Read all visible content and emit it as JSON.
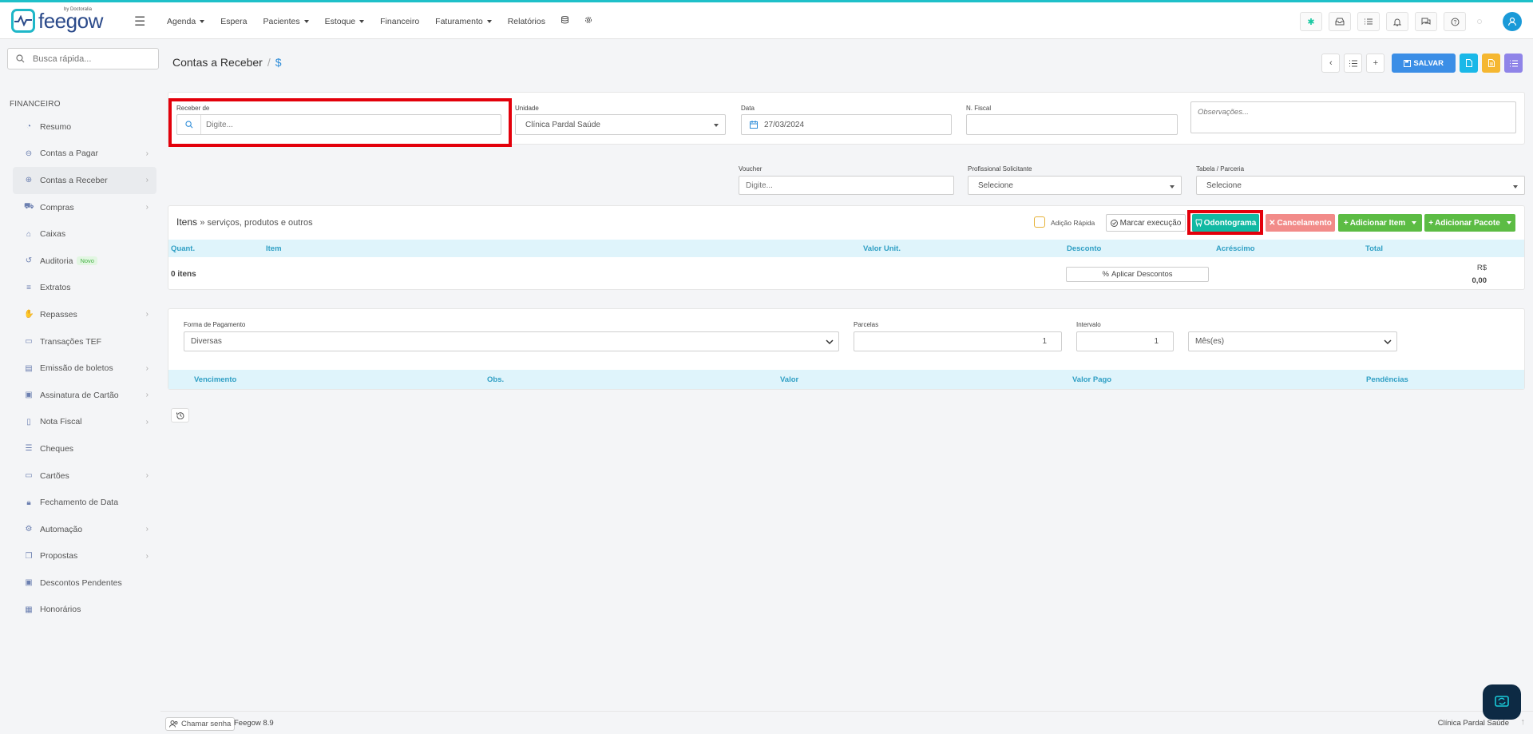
{
  "brand": {
    "name": "feegow",
    "sub": "by Doctoralia"
  },
  "topnav": {
    "items": [
      {
        "label": "Agenda",
        "dropdown": true
      },
      {
        "label": "Espera",
        "dropdown": false
      },
      {
        "label": "Pacientes",
        "dropdown": true
      },
      {
        "label": "Estoque",
        "dropdown": true
      },
      {
        "label": "Financeiro",
        "dropdown": false
      },
      {
        "label": "Faturamento",
        "dropdown": true
      },
      {
        "label": "Relatórios",
        "dropdown": false
      }
    ],
    "extra_icons": [
      "database-icon",
      "settings-icon"
    ]
  },
  "header_right": {
    "icons": [
      "star-icon",
      "inbox-icon",
      "tasks-icon",
      "bell-icon",
      "chat-icon",
      "help-icon"
    ]
  },
  "sidebar": {
    "search_placeholder": "Busca rápida...",
    "section_title": "FINANCEIRO",
    "items": [
      {
        "label": "Resumo",
        "icon": "chart-icon",
        "chevron": false
      },
      {
        "label": "Contas a Pagar",
        "icon": "minus-circle-icon",
        "chevron": true
      },
      {
        "label": "Contas a Receber",
        "icon": "plus-circle-icon",
        "chevron": true,
        "active": true
      },
      {
        "label": "Compras",
        "icon": "cart-icon",
        "chevron": true
      },
      {
        "label": "Caixas",
        "icon": "box-icon",
        "chevron": false
      },
      {
        "label": "Auditoria",
        "icon": "history-icon",
        "chevron": false,
        "badge": "Novo"
      },
      {
        "label": "Extratos",
        "icon": "list-icon",
        "chevron": false
      },
      {
        "label": "Repasses",
        "icon": "hand-icon",
        "chevron": true
      },
      {
        "label": "Transações TEF",
        "icon": "card-icon",
        "chevron": false
      },
      {
        "label": "Emissão de boletos",
        "icon": "barcode-icon",
        "chevron": true
      },
      {
        "label": "Assinatura de Cartão",
        "icon": "id-card-icon",
        "chevron": true
      },
      {
        "label": "Nota Fiscal",
        "icon": "file-icon",
        "chevron": true
      },
      {
        "label": "Cheques",
        "icon": "check-list-icon",
        "chevron": false
      },
      {
        "label": "Cartões",
        "icon": "credit-card-icon",
        "chevron": true
      },
      {
        "label": "Fechamento de Data",
        "icon": "lock-icon",
        "chevron": false
      },
      {
        "label": "Automação",
        "icon": "gears-icon",
        "chevron": true
      },
      {
        "label": "Propostas",
        "icon": "copy-icon",
        "chevron": true
      },
      {
        "label": "Descontos Pendentes",
        "icon": "money-icon",
        "chevron": false
      },
      {
        "label": "Honorários",
        "icon": "calendar-icon",
        "chevron": false
      }
    ]
  },
  "page": {
    "title": "Contas a Receber",
    "sep": "/",
    "symbol": "$"
  },
  "actions": {
    "save_label": "SALVAR"
  },
  "form": {
    "receber_de": {
      "label": "Receber de",
      "placeholder": "Digite..."
    },
    "unidade": {
      "label": "Unidade",
      "value": "Clínica Pardal Saúde"
    },
    "data": {
      "label": "Data",
      "value": "27/03/2024"
    },
    "nfiscal": {
      "label": "N. Fiscal",
      "value": ""
    },
    "observacoes": {
      "placeholder": "Observações..."
    },
    "voucher": {
      "label": "Voucher",
      "placeholder": "Digite..."
    },
    "profissional": {
      "label": "Profissional Solicitante",
      "value": "Selecione"
    },
    "tabela": {
      "label": "Tabela / Parceria",
      "value": "Selecione"
    }
  },
  "items": {
    "title": "Itens",
    "subtitle": "» serviços, produtos e outros",
    "quick_add_label": "Adição Rápida",
    "buttons": {
      "marcar": "Marcar execução",
      "odontograma": "Odontograma",
      "cancelamento": "Cancelamento",
      "adicionar_item": "Adicionar Item",
      "adicionar_pacote": "Adicionar Pacote"
    },
    "columns": [
      "Quant.",
      "Item",
      "Valor Unit.",
      "Desconto",
      "Acréscimo",
      "Total"
    ],
    "count_label": "0 itens",
    "apply_discounts": "Aplicar Descontos",
    "total_currency": "R$",
    "total_value": "0,00"
  },
  "payment": {
    "forma_label": "Forma de Pagamento",
    "forma_value": "Diversas",
    "parcelas_label": "Parcelas",
    "parcelas_value": "1",
    "intervalo_label": "Intervalo",
    "intervalo_value": "1",
    "period_value": "Mês(es)",
    "columns": [
      "Vencimento",
      "Obs.",
      "Valor",
      "Valor Pago",
      "Pendências"
    ]
  },
  "footer": {
    "call_label": "Chamar senha",
    "version": "Feegow 8.9",
    "clinic": "Clínica Pardal Saúde"
  },
  "colors": {
    "accent": "#1ec0c9",
    "primary": "#3b8ee6",
    "highlight": "#e3000b",
    "teal": "#12b9a3",
    "green": "#5cbc44",
    "red": "#f28b89"
  }
}
